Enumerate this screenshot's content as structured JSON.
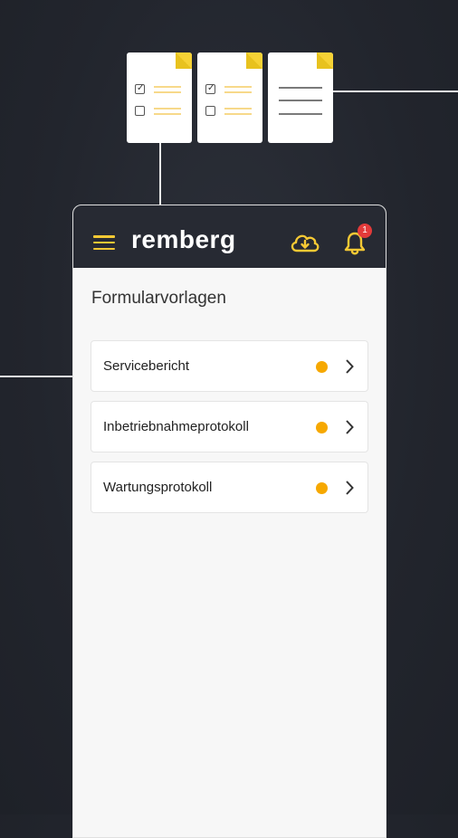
{
  "app": {
    "brand": "remberg",
    "notification_count": "1"
  },
  "page": {
    "title": "Formularvorlagen"
  },
  "templates": [
    {
      "label": "Servicebericht"
    },
    {
      "label": "Inbetriebnahmeprotokoll"
    },
    {
      "label": "Wartungsprotokoll"
    }
  ],
  "icons": {
    "menu": "hamburger-menu-icon",
    "cloud": "cloud-download-icon",
    "bell": "bell-icon",
    "chevron": "chevron-right-icon"
  },
  "colors": {
    "accent": "#f6c934",
    "status_dot": "#f6a800",
    "appbar": "#272a33",
    "badge": "#e23a3a",
    "background": "#23262e"
  }
}
